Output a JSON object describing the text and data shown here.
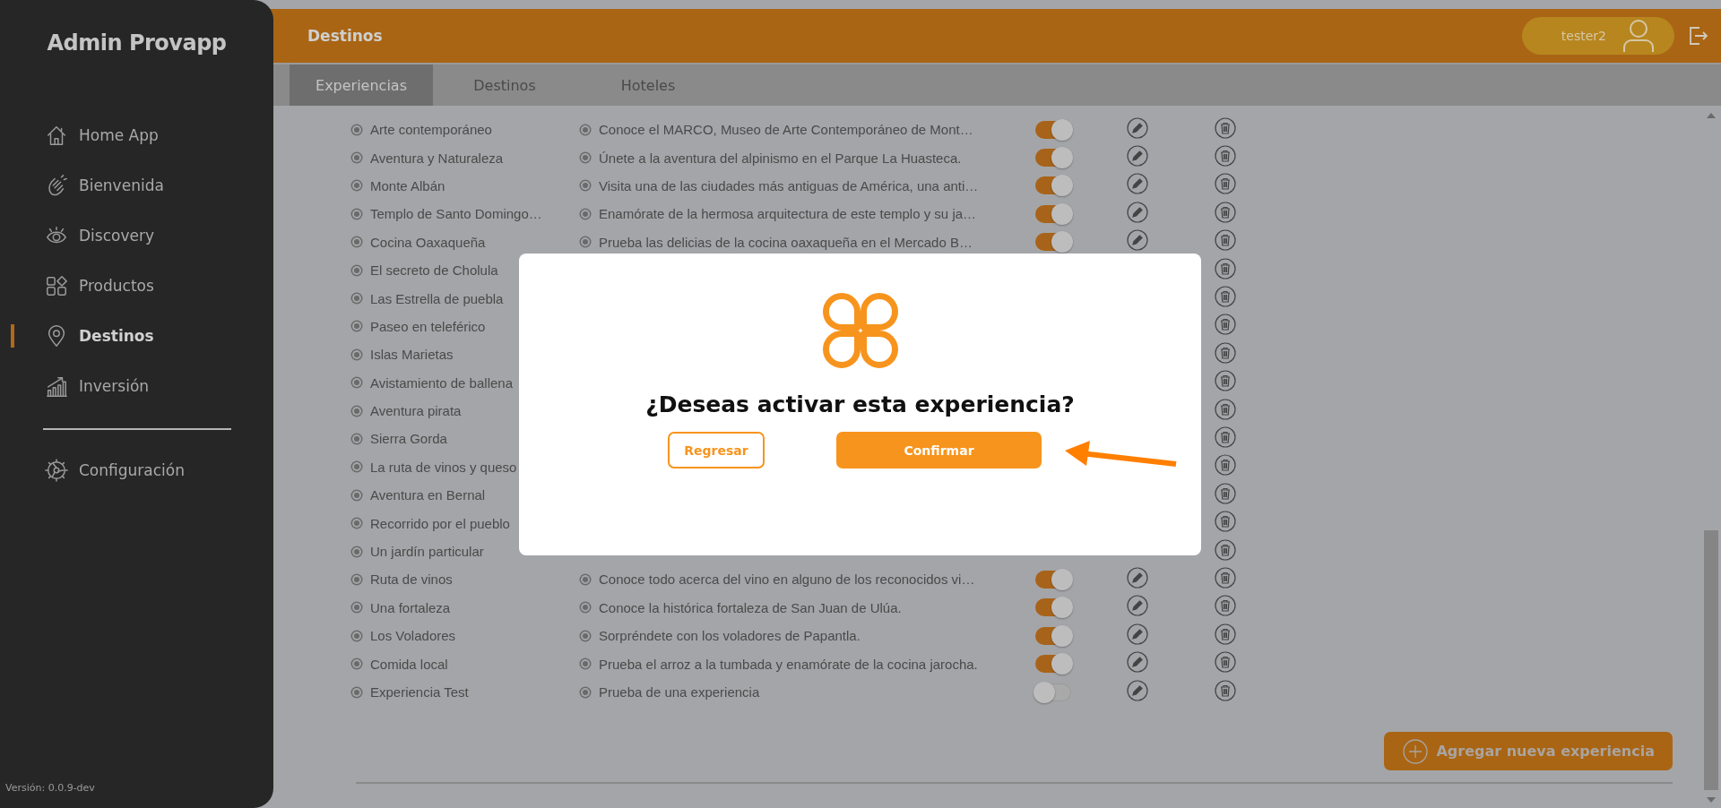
{
  "sidebar": {
    "title": "Admin Provapp",
    "items": [
      {
        "label": "Home App",
        "selected": false
      },
      {
        "label": "Bienvenida",
        "selected": false
      },
      {
        "label": "Discovery",
        "selected": false
      },
      {
        "label": "Productos",
        "selected": false
      },
      {
        "label": "Destinos",
        "selected": true
      },
      {
        "label": "Inversión",
        "selected": false
      }
    ],
    "settings": {
      "label": "Configuración",
      "selected": false
    },
    "version": "Versión: 0.0.9-dev"
  },
  "header": {
    "title": "Destinos",
    "user": "tester2"
  },
  "tabs": [
    {
      "label": "Experiencias",
      "selected": true
    },
    {
      "label": "Destinos",
      "selected": false
    },
    {
      "label": "Hoteles",
      "selected": false
    }
  ],
  "experiences": [
    {
      "name": "Arte contemporáneo",
      "description": "Conoce el MARCO, Museo de Arte Contemporáneo de Mont…",
      "active": true
    },
    {
      "name": "Aventura y Naturaleza",
      "description": "Únete a la aventura del alpinismo en el Parque La Huasteca.",
      "active": true
    },
    {
      "name": "Monte Albán",
      "description": "Visita una de las ciudades más antiguas de América, una anti…",
      "active": true
    },
    {
      "name": "Templo de Santo Domingo…",
      "description": "Enamórate de la hermosa arquitectura de este templo y su ja…",
      "active": true
    },
    {
      "name": "Cocina Oaxaqueña",
      "description": "Prueba las delicias de la cocina oaxaqueña en el Mercado B…",
      "active": true
    },
    {
      "name": "El secreto de Cholula"
    },
    {
      "name": "Las Estrella de puebla"
    },
    {
      "name": "Paseo en teleférico"
    },
    {
      "name": "Islas Marietas"
    },
    {
      "name": "Avistamiento de ballena"
    },
    {
      "name": "Aventura pirata"
    },
    {
      "name": "Sierra Gorda"
    },
    {
      "name": "La ruta de vinos y queso"
    },
    {
      "name": "Aventura en Bernal"
    },
    {
      "name": "Recorrido por el pueblo"
    },
    {
      "name": "Un jardín particular"
    },
    {
      "name": "Ruta de vinos",
      "description": "Conoce todo acerca del vino en alguno de los reconocidos vi…",
      "active": true
    },
    {
      "name": "Una fortaleza",
      "description": "Conoce la histórica fortaleza de San Juan de Ulúa.",
      "active": true
    },
    {
      "name": "Los Voladores",
      "description": "Sorpréndete con los voladores de Papantla.",
      "active": true
    },
    {
      "name": "Comida local",
      "description": "Prueba el arroz a la tumbada y enamórate de la cocina jarocha.",
      "active": true
    },
    {
      "name": "Experiencia Test",
      "description": "Prueba de una experiencia",
      "active": false
    }
  ],
  "add_button": "Agregar nueva experiencia",
  "dialog": {
    "title": "¿Deseas activar esta experiencia?",
    "buttons": [
      {
        "label": "Regresar",
        "kind": "secondary"
      },
      {
        "label": "Confirmar",
        "kind": "primary"
      }
    ]
  }
}
